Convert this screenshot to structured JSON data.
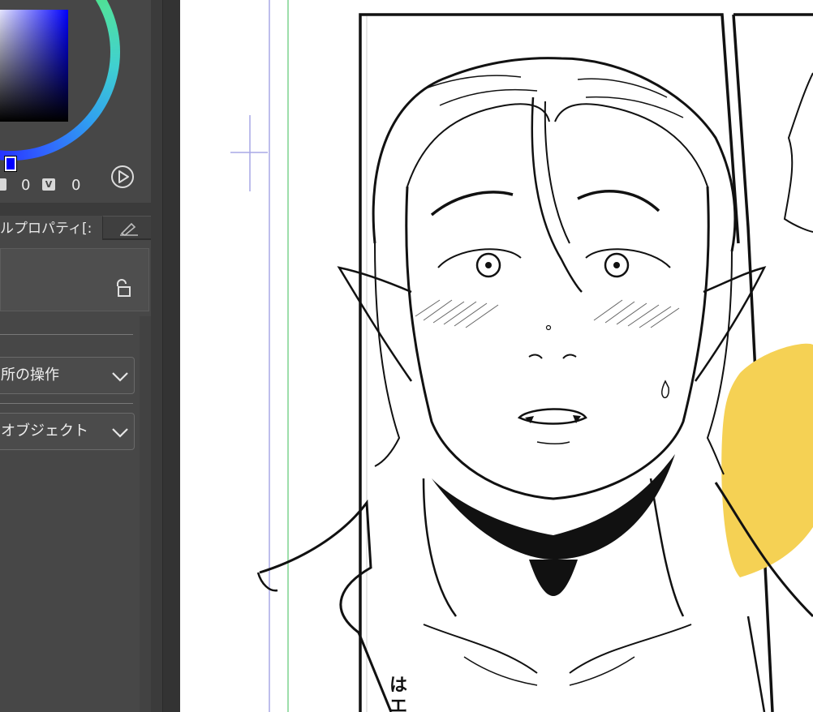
{
  "app": {
    "color_panel": {
      "value_labels": [
        "",
        "V"
      ],
      "values": [
        "0",
        "0"
      ],
      "main_color": "#0000ff"
    },
    "properties_tab": {
      "label": "ルプロパティ[:",
      "pen_icon": "pen-icon"
    },
    "tool_property": {
      "lock_icon": "lock-icon"
    },
    "dropdowns": [
      {
        "label": "所の操作"
      },
      {
        "label": "オブジェクト"
      }
    ]
  },
  "canvas": {
    "speech_text": [
      "は",
      "エ"
    ],
    "colors": {
      "blob": "#f5d154",
      "guide_blue": "#a9a9e6",
      "guide_green": "#7fd38f"
    }
  }
}
